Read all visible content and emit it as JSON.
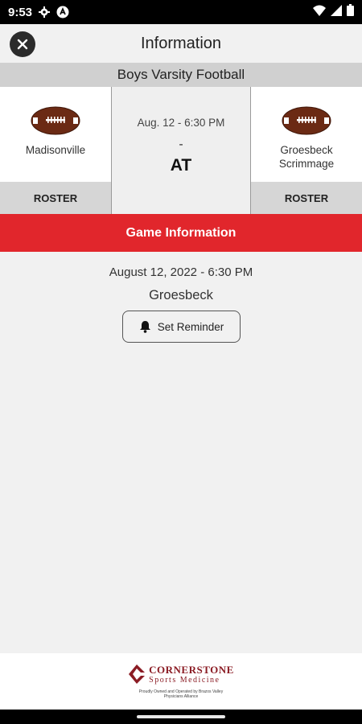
{
  "status_bar": {
    "time": "9:53"
  },
  "header": {
    "title": "Information"
  },
  "sport": {
    "label": "Boys Varsity Football"
  },
  "matchup": {
    "home_team": {
      "name": "Madisonville",
      "roster_label": "ROSTER"
    },
    "away_team": {
      "name": "Groesbeck Scrimmage",
      "roster_label": "ROSTER"
    },
    "date_time": "Aug. 12 - 6:30 PM",
    "score": "-",
    "vs_label": "AT"
  },
  "game_info": {
    "header": "Game Information",
    "date_time": "August 12, 2022 - 6:30 PM",
    "location": "Groesbeck",
    "reminder_label": "Set Reminder"
  },
  "footer": {
    "sponsor_name": "CORNERSTONE",
    "sponsor_sub": "Sports Medicine",
    "sponsor_tagline": "Proudly Owned and Operated by Brazos Valley Physicians Alliance"
  },
  "colors": {
    "accent": "#e1262c",
    "brand": "#8b1c24"
  }
}
